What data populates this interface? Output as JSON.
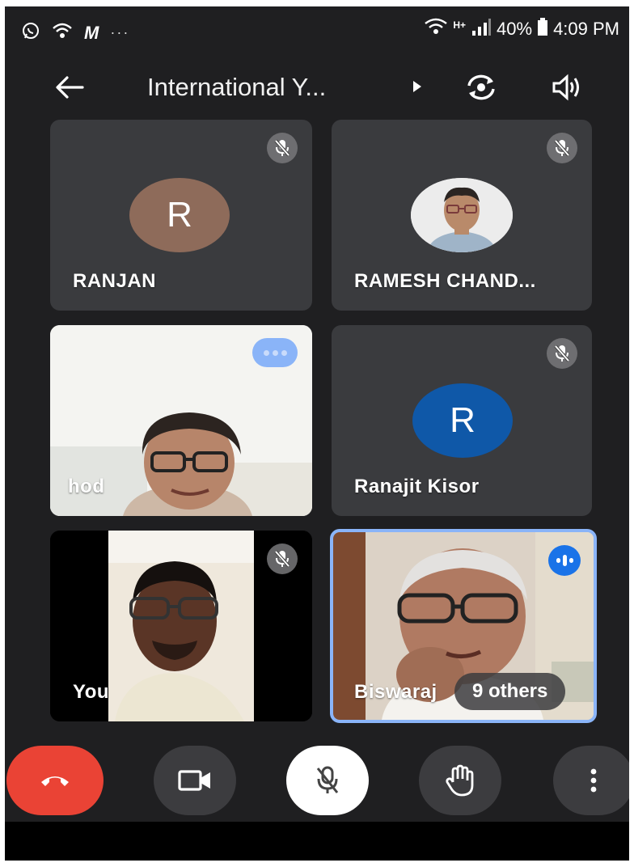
{
  "status_bar": {
    "battery": "40%",
    "time": "4:09 PM",
    "network": "H+",
    "overflow": "···"
  },
  "top_bar": {
    "meeting_title": "International Y..."
  },
  "tiles": [
    {
      "name": "RANJAN",
      "avatar_letter": "R",
      "muted": true
    },
    {
      "name": "RAMESH CHAND...",
      "muted": true
    },
    {
      "name": "hod",
      "muted": false
    },
    {
      "name": "Ranajit Kisor",
      "avatar_letter": "R",
      "muted": true
    },
    {
      "name": "You",
      "muted": true
    },
    {
      "name": "Biswaraj",
      "speaking": true,
      "others_label": "9 others"
    }
  ],
  "colors": {
    "background": "#1f1f21",
    "tile": "#3a3b3e",
    "end_call": "#ea4335",
    "active_speaker_border": "#8ab4f8",
    "avatar_brown": "#8e6b5a",
    "avatar_blue": "#0f58a8"
  },
  "icons": {
    "back": "arrow-left-icon",
    "switch_camera": "switch-camera-icon",
    "speaker": "speaker-icon",
    "mute": "mic-off-icon",
    "end_call": "phone-hangup-icon",
    "camera": "video-camera-icon",
    "raise_hand": "hand-icon",
    "more": "more-vertical-icon"
  }
}
